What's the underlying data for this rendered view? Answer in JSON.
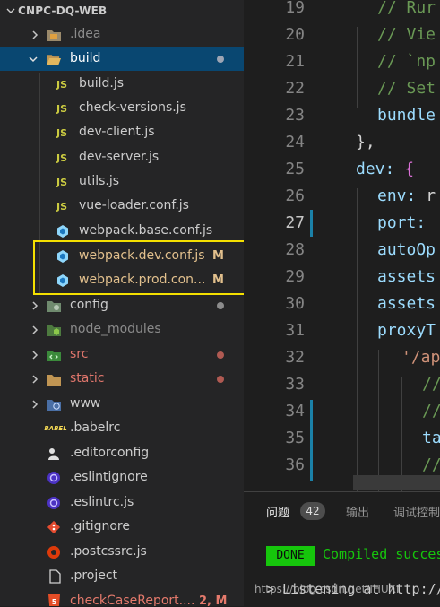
{
  "explorer": {
    "title": "CNPC-DQ-WEB",
    "items": [
      {
        "label": ".idea",
        "type": "folder",
        "state": "collapsed"
      },
      {
        "label": "build",
        "type": "folder",
        "state": "expanded"
      },
      {
        "label": "build.js",
        "type": "js"
      },
      {
        "label": "check-versions.js",
        "type": "js"
      },
      {
        "label": "dev-client.js",
        "type": "js"
      },
      {
        "label": "dev-server.js",
        "type": "js"
      },
      {
        "label": "utils.js",
        "type": "js"
      },
      {
        "label": "vue-loader.conf.js",
        "type": "js"
      },
      {
        "label": "webpack.base.conf.js",
        "type": "webpack"
      },
      {
        "label": "webpack.dev.conf.js",
        "type": "webpack",
        "badge": "M"
      },
      {
        "label": "webpack.prod.con...",
        "type": "webpack",
        "badge": "M"
      },
      {
        "label": "config",
        "type": "folder",
        "state": "collapsed"
      },
      {
        "label": "node_modules",
        "type": "folder",
        "state": "collapsed"
      },
      {
        "label": "src",
        "type": "folder",
        "state": "collapsed"
      },
      {
        "label": "static",
        "type": "folder",
        "state": "collapsed"
      },
      {
        "label": "www",
        "type": "folder",
        "state": "collapsed"
      },
      {
        "label": ".babelrc",
        "type": "babel",
        "icon_text": "BABEL"
      },
      {
        "label": ".editorconfig",
        "type": "editorconfig"
      },
      {
        "label": ".eslintignore",
        "type": "eslint"
      },
      {
        "label": ".eslintrc.js",
        "type": "eslint"
      },
      {
        "label": ".gitignore",
        "type": "git"
      },
      {
        "label": ".postcssrc.js",
        "type": "postcss"
      },
      {
        "label": ".project",
        "type": "file"
      },
      {
        "label": "checkCaseReport....",
        "type": "html",
        "badge": "2, M"
      }
    ],
    "js_icon_text": "JS"
  },
  "editor": {
    "lines": [
      {
        "num": "19",
        "text": "// Rur"
      },
      {
        "num": "20",
        "text": "// Vie"
      },
      {
        "num": "21",
        "text": "// `np"
      },
      {
        "num": "22",
        "text": "// Set"
      },
      {
        "num": "23",
        "text": "bundle"
      },
      {
        "num": "24",
        "text": "},"
      },
      {
        "num": "25",
        "key": "dev:",
        "rest": " {"
      },
      {
        "num": "26",
        "key": "env:",
        "rest": " r"
      },
      {
        "num": "27",
        "key": "port:",
        "rest": " "
      },
      {
        "num": "28",
        "key": "autoOp",
        "rest": ""
      },
      {
        "num": "29",
        "key": "assets",
        "rest": ""
      },
      {
        "num": "30",
        "key": "assets",
        "rest": ""
      },
      {
        "num": "31",
        "key": "proxyT",
        "rest": ""
      },
      {
        "num": "32",
        "text": "'/ap"
      },
      {
        "num": "33",
        "text": "//"
      },
      {
        "num": "34",
        "text": "//"
      },
      {
        "num": "35",
        "text": "ta"
      },
      {
        "num": "36",
        "text": "//"
      }
    ]
  },
  "panel": {
    "tabs": {
      "problems": "问题",
      "problems_count": "42",
      "output": "输出",
      "debug": "调试控制"
    },
    "done": "DONE",
    "compiled": "Compiled succes",
    "listening": "> Listening at http://",
    "watermark": "https://blog.csdn.net/IHUXI"
  }
}
